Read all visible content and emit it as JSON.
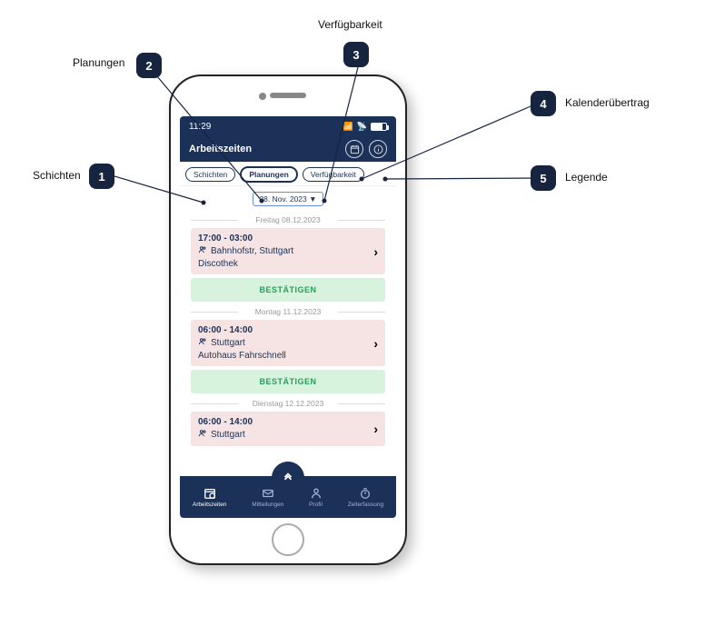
{
  "status": {
    "time": "11:29"
  },
  "appbar": {
    "title": "Arbeitszeiten"
  },
  "tabs": {
    "schichten": "Schichten",
    "planungen": "Planungen",
    "verfuegbarkeit": "Verfügbarkeit"
  },
  "date_picker": "28. Nov. 2023 ▼",
  "confirm_label": "BESTÄTIGEN",
  "days": [
    {
      "label": "Freitag 08.12.2023",
      "entry": {
        "time": "17:00 - 03:00",
        "loc": "Bahnhofstr, Stuttgart",
        "place": "Discothek"
      }
    },
    {
      "label": "Montag 11.12.2023",
      "entry": {
        "time": "06:00 - 14:00",
        "loc": "Stuttgart",
        "place": "Autohaus Fahrschnell"
      }
    },
    {
      "label": "Dienstag 12.12.2023",
      "entry": {
        "time": "06:00 - 14:00",
        "loc": "Stuttgart",
        "place": ""
      }
    }
  ],
  "tabbar": {
    "arbeitszeiten": "Arbeitszeiten",
    "mitteilungen": "Mitteilungen",
    "profil": "Profil",
    "zeiterfassung": "Zeiterfassung"
  },
  "callouts": {
    "1": "Schichten",
    "2": "Planungen",
    "3": "Verfügbarkeit",
    "4": "Kalenderübertrag",
    "5": "Legende"
  }
}
